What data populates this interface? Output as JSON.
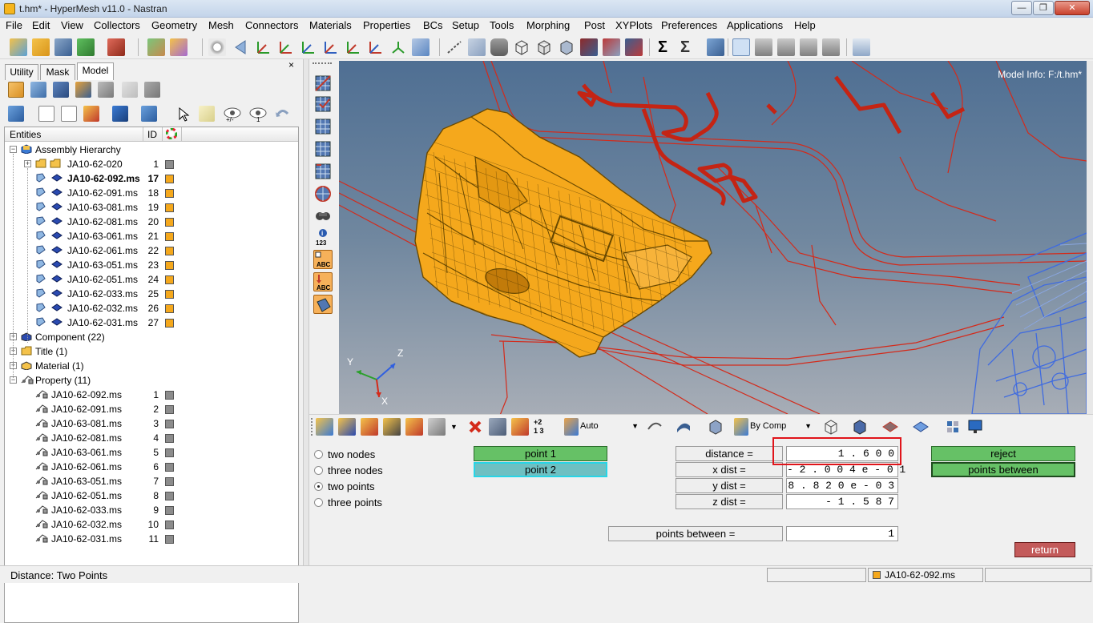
{
  "window": {
    "title": "t.hm* - HyperMesh v11.0 - Nastran"
  },
  "menu": [
    "File",
    "Edit",
    "View",
    "Collectors",
    "Geometry",
    "Mesh",
    "Connectors",
    "Materials",
    "Properties",
    "BCs",
    "Setup",
    "Tools",
    "Morphing",
    "Post",
    "XYPlots",
    "Preferences",
    "Applications",
    "Help"
  ],
  "browser": {
    "tabs": [
      "Utility",
      "Mask",
      "Model"
    ],
    "active_tab": "Model",
    "close_label": "×",
    "columns": {
      "entities": "Entities",
      "id": "ID"
    },
    "assembly_hierarchy": "Assembly Hierarchy",
    "assembly": {
      "name": "JA10-62-020",
      "id": "1"
    },
    "assembly_components": [
      {
        "name": "JA10-62-092.ms",
        "id": "17",
        "bold": true
      },
      {
        "name": "JA10-62-091.ms",
        "id": "18"
      },
      {
        "name": "JA10-63-081.ms",
        "id": "19"
      },
      {
        "name": "JA10-62-081.ms",
        "id": "20"
      },
      {
        "name": "JA10-63-061.ms",
        "id": "21"
      },
      {
        "name": "JA10-62-061.ms",
        "id": "22"
      },
      {
        "name": "JA10-63-051.ms",
        "id": "23"
      },
      {
        "name": "JA10-62-051.ms",
        "id": "24"
      },
      {
        "name": "JA10-62-033.ms",
        "id": "25"
      },
      {
        "name": "JA10-62-032.ms",
        "id": "26"
      },
      {
        "name": "JA10-62-031.ms",
        "id": "27"
      }
    ],
    "groups": {
      "component": "Component (22)",
      "title": "Title (1)",
      "material": "Material (1)",
      "property": "Property (11)"
    },
    "properties": [
      {
        "name": "JA10-62-092.ms",
        "id": "1"
      },
      {
        "name": "JA10-62-091.ms",
        "id": "2"
      },
      {
        "name": "JA10-63-081.ms",
        "id": "3"
      },
      {
        "name": "JA10-62-081.ms",
        "id": "4"
      },
      {
        "name": "JA10-63-061.ms",
        "id": "5"
      },
      {
        "name": "JA10-62-061.ms",
        "id": "6"
      },
      {
        "name": "JA10-63-051.ms",
        "id": "7"
      },
      {
        "name": "JA10-62-051.ms",
        "id": "8"
      },
      {
        "name": "JA10-62-033.ms",
        "id": "9"
      },
      {
        "name": "JA10-62-032.ms",
        "id": "10"
      },
      {
        "name": "JA10-62-031.ms",
        "id": "11"
      }
    ]
  },
  "graphics": {
    "model_info": "Model Info: F:/t.hm*",
    "triad": {
      "x": "X",
      "y": "Y",
      "z": "Z"
    },
    "component_color": "#f5a81c",
    "background_top": "#4f6f93",
    "background_bottom": "#a7adb6"
  },
  "bottom_toolbar": {
    "elem_display": "Auto",
    "color_mode": "By Comp"
  },
  "panel": {
    "options": [
      {
        "label": "two nodes",
        "selected": false
      },
      {
        "label": "three nodes",
        "selected": false
      },
      {
        "label": "two points",
        "selected": true
      },
      {
        "label": "three points",
        "selected": false
      }
    ],
    "point1": "point 1",
    "point2": "point 2",
    "distance_label": "distance =",
    "distance_value": "1 . 6 0 0",
    "xdist_label": "x dist  =",
    "xdist_value": "- 2 . 0 0 4 e - 0 1",
    "ydist_label": "y dist  =",
    "ydist_value": "8 . 8 2 0 e - 0 3",
    "zdist_label": "z dist  =",
    "zdist_value": "- 1 . 5 8 7",
    "points_between_label": "points between =",
    "points_between_value": "1",
    "reject": "reject",
    "points_between_btn": "points between",
    "return": "return"
  },
  "status": {
    "message": "Distance:  Two Points",
    "current_component": "JA10-62-092.ms"
  },
  "colors": {
    "active_color": "#f5a81c",
    "inactive_color": "#8c8c8c",
    "highlight": "#e0141a"
  }
}
